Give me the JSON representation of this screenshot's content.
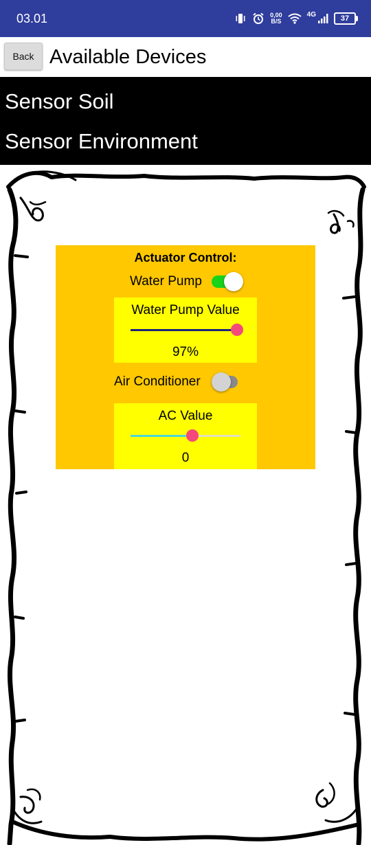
{
  "status_bar": {
    "time": "03.01",
    "net_speed_value": "0,00",
    "net_speed_unit": "B/S",
    "network_type": "4G",
    "battery": "37"
  },
  "header": {
    "back_label": "Back",
    "title": "Available Devices"
  },
  "devices": [
    {
      "label": "Sensor Soil"
    },
    {
      "label": "Sensor Environment"
    }
  ],
  "actuator": {
    "title": "Actuator Control:",
    "water_pump": {
      "label": "Water Pump",
      "on": true,
      "slider_label": "Water Pump Value",
      "slider_fraction": 0.97,
      "value_text": "97%"
    },
    "air_conditioner": {
      "label": "Air Conditioner",
      "on": false,
      "slider_label": "AC Value",
      "slider_fraction": 0.56,
      "value_text": "0"
    }
  },
  "colors": {
    "status_bar": "#2f3d9c",
    "panel_bg": "#ffc800",
    "slider_box_bg": "#ffff00",
    "switch_on": "#19d31a",
    "slider_knob": "#f44a7b",
    "pump_fill": "#1a237e",
    "ac_fill": "#4dd6d6",
    "slider_rail": "#e0e0c0"
  }
}
